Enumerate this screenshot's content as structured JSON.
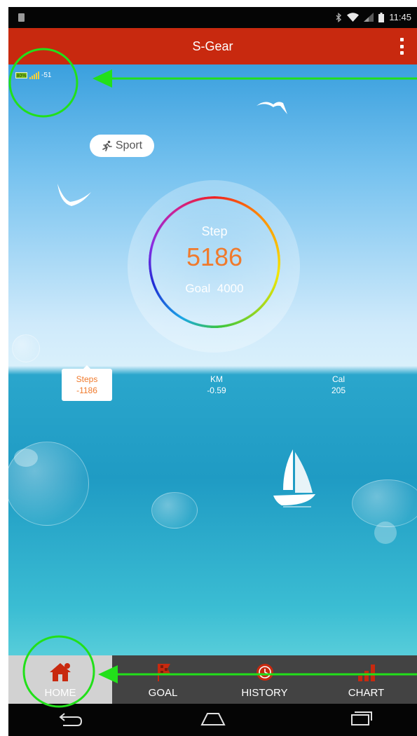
{
  "status_bar": {
    "time": "11:45",
    "icons": [
      "notification-icon",
      "bluetooth-icon",
      "wifi-icon",
      "cell-signal-icon",
      "battery-icon"
    ]
  },
  "app_bar": {
    "title": "S-Gear",
    "menu_icon": "overflow-menu-icon"
  },
  "device_status": {
    "battery_text": "80%",
    "signal_icon": "signal-bars-icon",
    "signal_value": "-51"
  },
  "sport_button": {
    "icon": "running-icon",
    "label": "Sport"
  },
  "progress": {
    "step_label": "Step",
    "step_value": "5186",
    "goal_label": "Goal",
    "goal_value": "4000"
  },
  "stats": {
    "steps": {
      "label": "Steps",
      "value": "-1186"
    },
    "km": {
      "label": "KM",
      "value": "-0.59"
    },
    "cal": {
      "label": "Cal",
      "value": "205"
    }
  },
  "tabs": [
    {
      "label": "HOME",
      "icon": "home-icon",
      "active": true
    },
    {
      "label": "GOAL",
      "icon": "flag-icon",
      "active": false
    },
    {
      "label": "HISTORY",
      "icon": "clock-icon",
      "active": false
    },
    {
      "label": "CHART",
      "icon": "bar-chart-icon",
      "active": false
    }
  ],
  "nav_bar": [
    "back-icon",
    "home-nav-icon",
    "recents-icon"
  ],
  "colors": {
    "app_bar": "#c8290f",
    "accent_orange": "#f07a2c",
    "tab_bar": "#434343",
    "tab_active": "#d2d2d2",
    "annotation_green": "#22e01a"
  }
}
